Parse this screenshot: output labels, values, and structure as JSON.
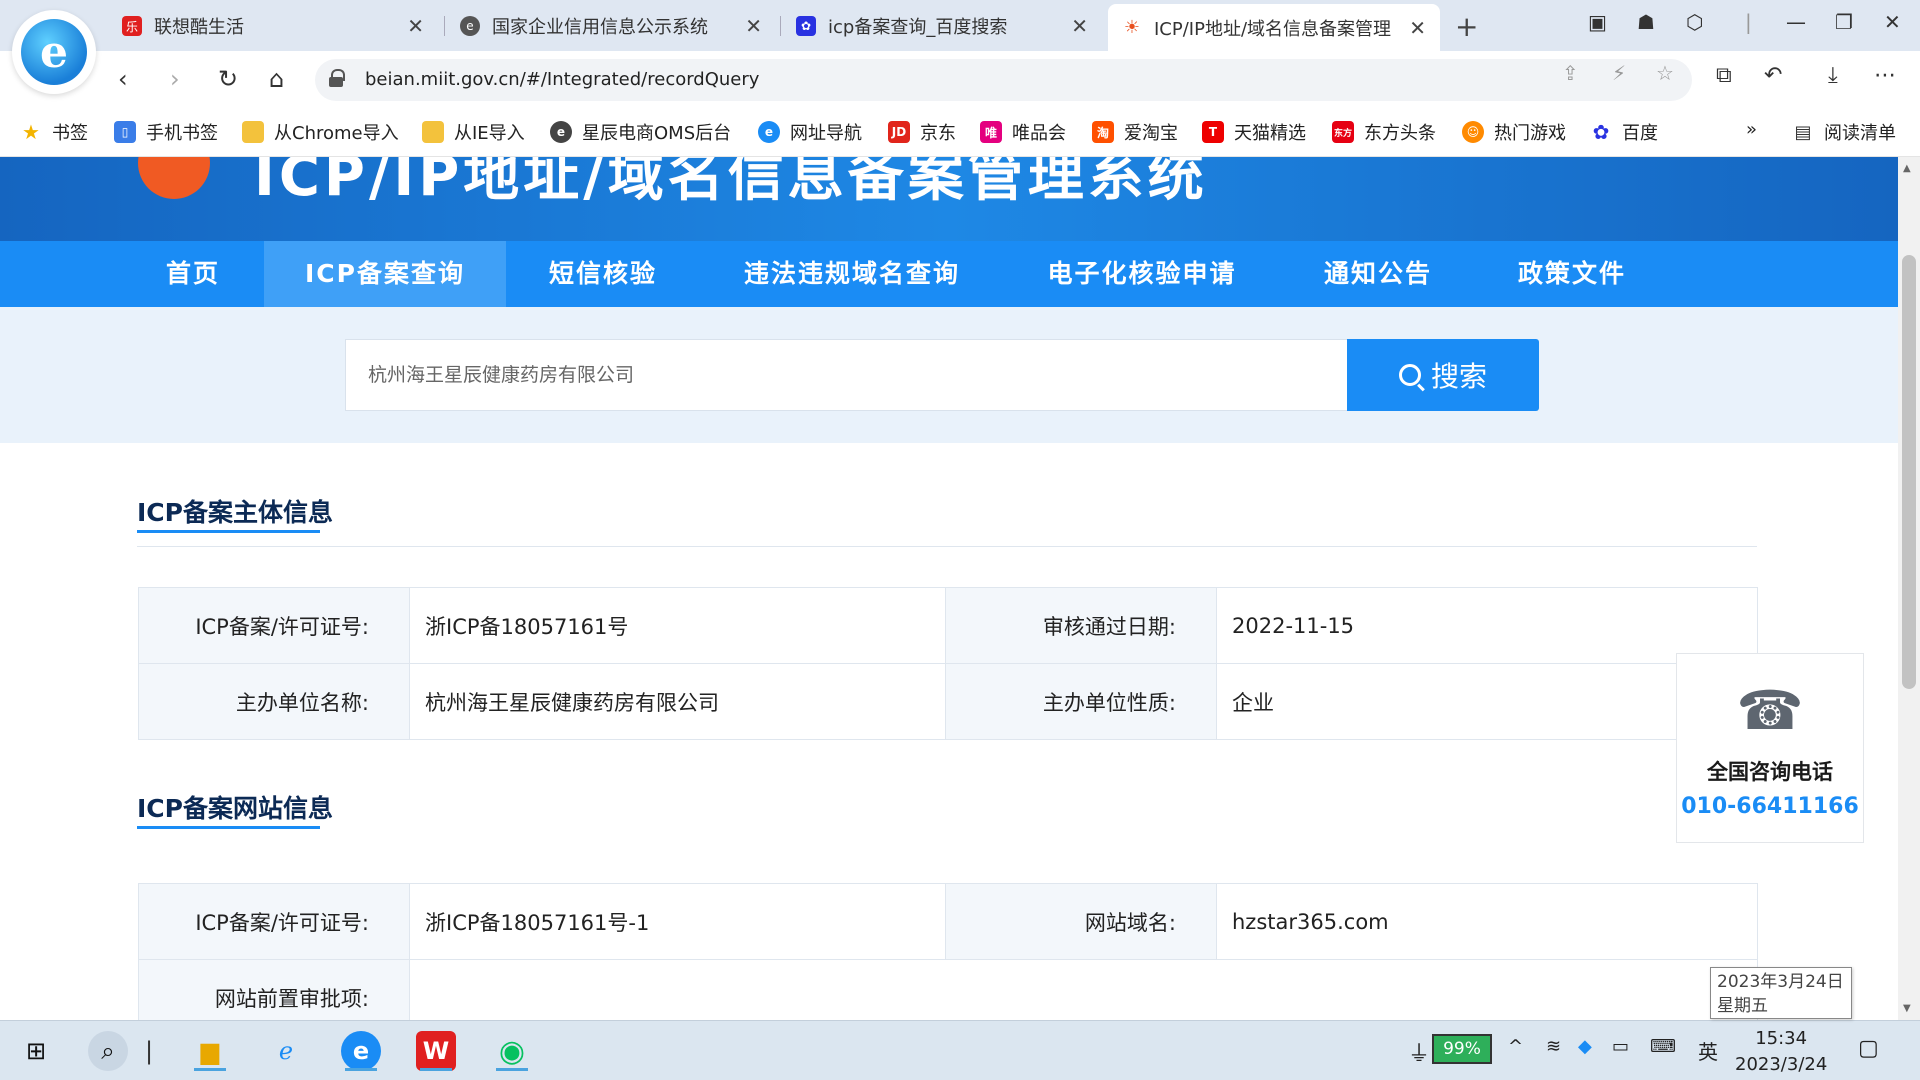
{
  "browser": {
    "tabs": [
      {
        "title": "联想酷生活",
        "active": false
      },
      {
        "title": "国家企业信用信息公示系统",
        "active": false
      },
      {
        "title": "icp备案查询_百度搜索",
        "active": false
      },
      {
        "title": "ICP/IP地址/域名信息备案管理",
        "active": true
      }
    ],
    "url": "beian.miit.gov.cn/#/Integrated/recordQuery",
    "bookmarks": [
      "书签",
      "手机书签",
      "从Chrome导入",
      "从IE导入",
      "星辰电商OMS后台",
      "网址导航",
      "京东",
      "唯品会",
      "爱淘宝",
      "天猫精选",
      "东方头条",
      "热门游戏",
      "百度"
    ],
    "more_bookmarks": "»",
    "reading_list": "阅读清单"
  },
  "site": {
    "title": "ICP/IP地址/域名信息备案管理系统",
    "nav": [
      "首页",
      "ICP备案查询",
      "短信核验",
      "违法违规域名查询",
      "电子化核验申请",
      "通知公告",
      "政策文件"
    ],
    "active_nav": 1,
    "search": {
      "value": "杭州海王星辰健康药房有限公司",
      "button": "搜索"
    }
  },
  "subject_section": {
    "title": "ICP备案主体信息",
    "rows": [
      {
        "l1": "ICP备案/许可证号:",
        "v1": "浙ICP备18057161号",
        "l2": "审核通过日期:",
        "v2": "2022-11-15"
      },
      {
        "l1": "主办单位名称:",
        "v1": "杭州海王星辰健康药房有限公司",
        "l2": "主办单位性质:",
        "v2": "企业"
      }
    ]
  },
  "website_section": {
    "title": "ICP备案网站信息",
    "rows": [
      {
        "l1": "ICP备案/许可证号:",
        "v1": "浙ICP备18057161号-1",
        "l2": "网站域名:",
        "v2": "hzstar365.com"
      },
      {
        "l1": "网站前置审批项:",
        "v1": "",
        "l2": "",
        "v2": ""
      }
    ]
  },
  "consult": {
    "label": "全国咨询电话",
    "phone": "010-66411166"
  },
  "taskbar": {
    "battery": "99%",
    "ime": "英",
    "time": "15:34",
    "date": "2023/3/24",
    "tooltip_date": "2023年3月24日",
    "tooltip_weekday": "星期五"
  },
  "colors": {
    "nav_blue": "#1a8cf5",
    "nav_active": "#3fa0f7",
    "phone_blue": "#1a8cf5",
    "banner_blue": "#1565c0"
  }
}
